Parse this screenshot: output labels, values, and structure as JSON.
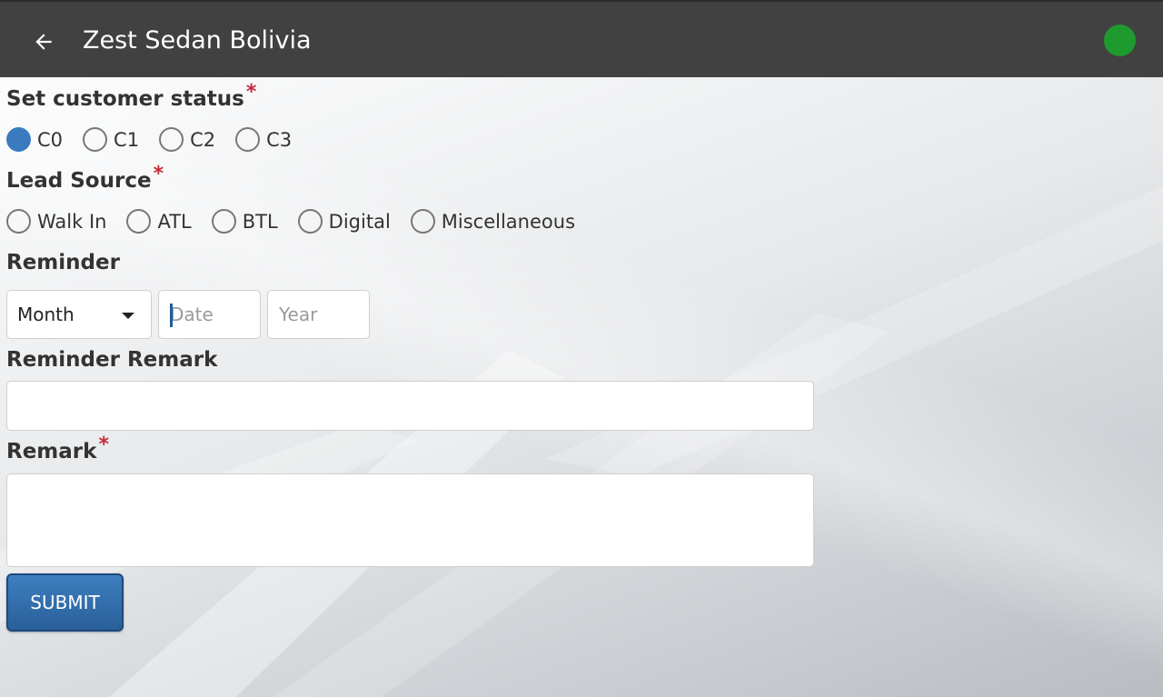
{
  "header": {
    "title": "Zest Sedan Bolivia",
    "status_color": "#1f9a2e",
    "back_icon": "arrow-back-icon"
  },
  "customer_status": {
    "label": "Set customer status",
    "required_mark": "*",
    "options": [
      {
        "label": "C0",
        "checked": true
      },
      {
        "label": "C1",
        "checked": false
      },
      {
        "label": "C2",
        "checked": false
      },
      {
        "label": "C3",
        "checked": false
      }
    ]
  },
  "lead_source": {
    "label": "Lead Source",
    "required_mark": "*",
    "options": [
      {
        "label": "Walk In",
        "checked": false
      },
      {
        "label": "ATL",
        "checked": false
      },
      {
        "label": "BTL",
        "checked": false
      },
      {
        "label": "Digital",
        "checked": false
      },
      {
        "label": "Miscellaneous",
        "checked": false
      }
    ]
  },
  "reminder": {
    "label": "Reminder",
    "month_value": "Month",
    "date_placeholder": "Date",
    "year_placeholder": "Year"
  },
  "reminder_remark": {
    "label": "Reminder Remark",
    "value": ""
  },
  "remark": {
    "label": "Remark",
    "required_mark": "*",
    "value": ""
  },
  "submit_label": "SUBMIT",
  "colors": {
    "appbar": "#414141",
    "radio_checked": "#3a7bbf",
    "required": "#c62b3a",
    "button": "#2f6aa8"
  }
}
